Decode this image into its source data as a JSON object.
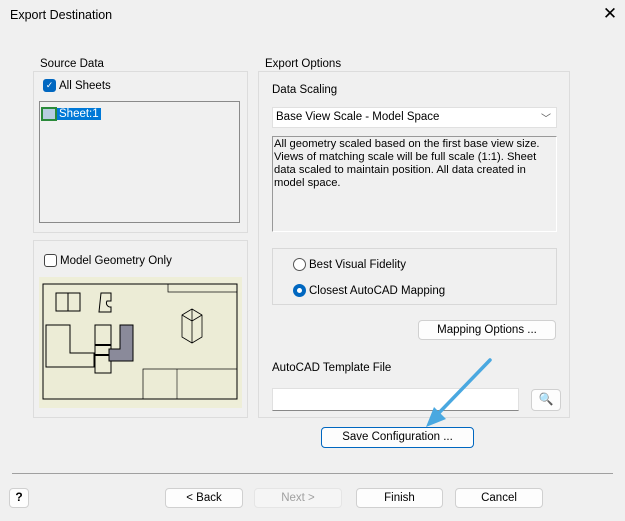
{
  "window": {
    "title": "Export Destination",
    "close": "✕"
  },
  "source": {
    "legend": "Source Data",
    "all_sheets": "All Sheets",
    "sheets": [
      "Sheet:1"
    ]
  },
  "preview": {
    "model_geometry_only": "Model Geometry Only"
  },
  "export": {
    "legend": "Export Options",
    "scaling_label": "Data Scaling",
    "scaling_value": "Base View Scale - Model Space",
    "description": "All geometry scaled based on the first base view size. Views of matching scale will be full scale (1:1). Sheet data scaled to maintain position. All data created in model space.",
    "radio_best": "Best Visual Fidelity",
    "radio_closest": "Closest AutoCAD Mapping",
    "mapping_button": "Mapping Options ...",
    "template_label": "AutoCAD Template File",
    "template_value": ""
  },
  "save_button": "Save Configuration ...",
  "footer": {
    "help": "?",
    "back": "< Back",
    "next": "Next >",
    "finish": "Finish",
    "cancel": "Cancel"
  },
  "colors": {
    "accent": "#0067c0",
    "arrow": "#4aa8e0"
  }
}
